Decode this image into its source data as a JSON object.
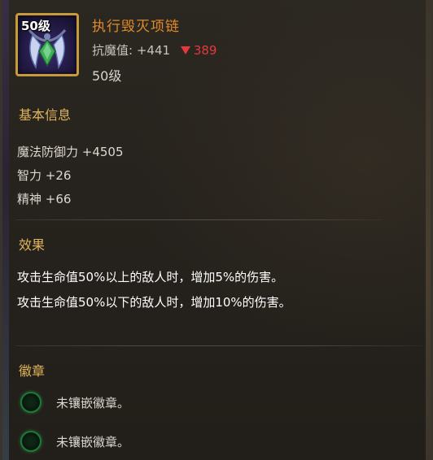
{
  "item": {
    "level_badge": "50级",
    "name": "执行毁灭项链",
    "resist_label": "抗魔值:",
    "resist_value": "+441",
    "resist_delta": "389",
    "required_level": "50级",
    "icon": "necklace-icon"
  },
  "basic_info": {
    "title": "基本信息",
    "stats": [
      "魔法防御力 +4505",
      "智力 +26",
      "精神 +66"
    ]
  },
  "effects": {
    "title": "效果",
    "lines": [
      "攻击生命值50%以上的敌人时，增加5%的伤害。",
      "攻击生命值50%以下的敌人时，增加10%的伤害。"
    ]
  },
  "badges": {
    "title": "徽章",
    "slots": [
      {
        "label": "未镶嵌徽章。"
      },
      {
        "label": "未镶嵌徽章。"
      }
    ]
  },
  "colors": {
    "item_name": "#e08a2a",
    "section_title": "#e0b45a",
    "delta_down": "#e4393c",
    "icon_border": "#c79a3a",
    "badge_ring": "#1f7a3a"
  }
}
